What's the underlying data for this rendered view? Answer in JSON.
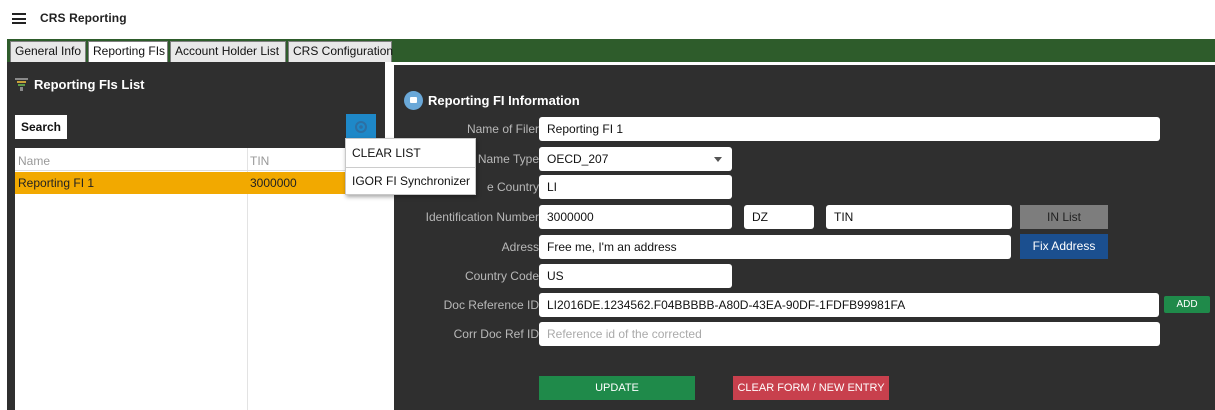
{
  "app": {
    "title": "CRS Reporting"
  },
  "tabs": [
    {
      "label": "General Info"
    },
    {
      "label": "Reporting FIs"
    },
    {
      "label": "Account Holder List"
    },
    {
      "label": "CRS Configuration"
    }
  ],
  "left": {
    "title": "Reporting FIs List",
    "search_label": "Search",
    "columns": {
      "name": "Name",
      "tin": "TIN"
    },
    "rows": [
      {
        "name": "Reporting FI 1",
        "tin": "3000000"
      }
    ]
  },
  "menu": {
    "items": [
      {
        "label": "CLEAR LIST"
      },
      {
        "label": "IGOR FI Synchronizer"
      }
    ]
  },
  "form": {
    "title": "Reporting FI Information",
    "name_of_filer": {
      "label": "Name of Filer",
      "value": "Reporting FI 1"
    },
    "name_type": {
      "label": "Name Type",
      "value": "OECD_207"
    },
    "residence_country": {
      "label": "e Country",
      "value": "LI"
    },
    "identification": {
      "label": "Identification Number",
      "value": "3000000",
      "country": "DZ",
      "type": "TIN",
      "in_list_label": "IN List"
    },
    "address": {
      "label": "Adress",
      "value": "Free me, I'm an address",
      "fix_label": "Fix Address"
    },
    "country_code": {
      "label": "Country Code",
      "value": "US"
    },
    "doc_ref": {
      "label": "Doc Reference ID",
      "value": "LI2016DE.1234562.F04BBBBB-A80D-43EA-90DF-1FDFB99981FA",
      "add_label": "ADD"
    },
    "corr_doc_ref": {
      "label": "Corr Doc Ref ID",
      "placeholder": "Reference id of the corrected"
    },
    "update_label": "UPDATE",
    "clear_label": "CLEAR FORM / NEW ENTRY"
  },
  "colors": {
    "tabstrip": "#2e5c2b",
    "panel": "#2f2f2f",
    "selected_row": "#f2a900",
    "settings_btn": "#1e88c8",
    "fix_btn": "#1b4f8f",
    "update_btn": "#1f8a4a",
    "clear_btn": "#c8404d"
  }
}
